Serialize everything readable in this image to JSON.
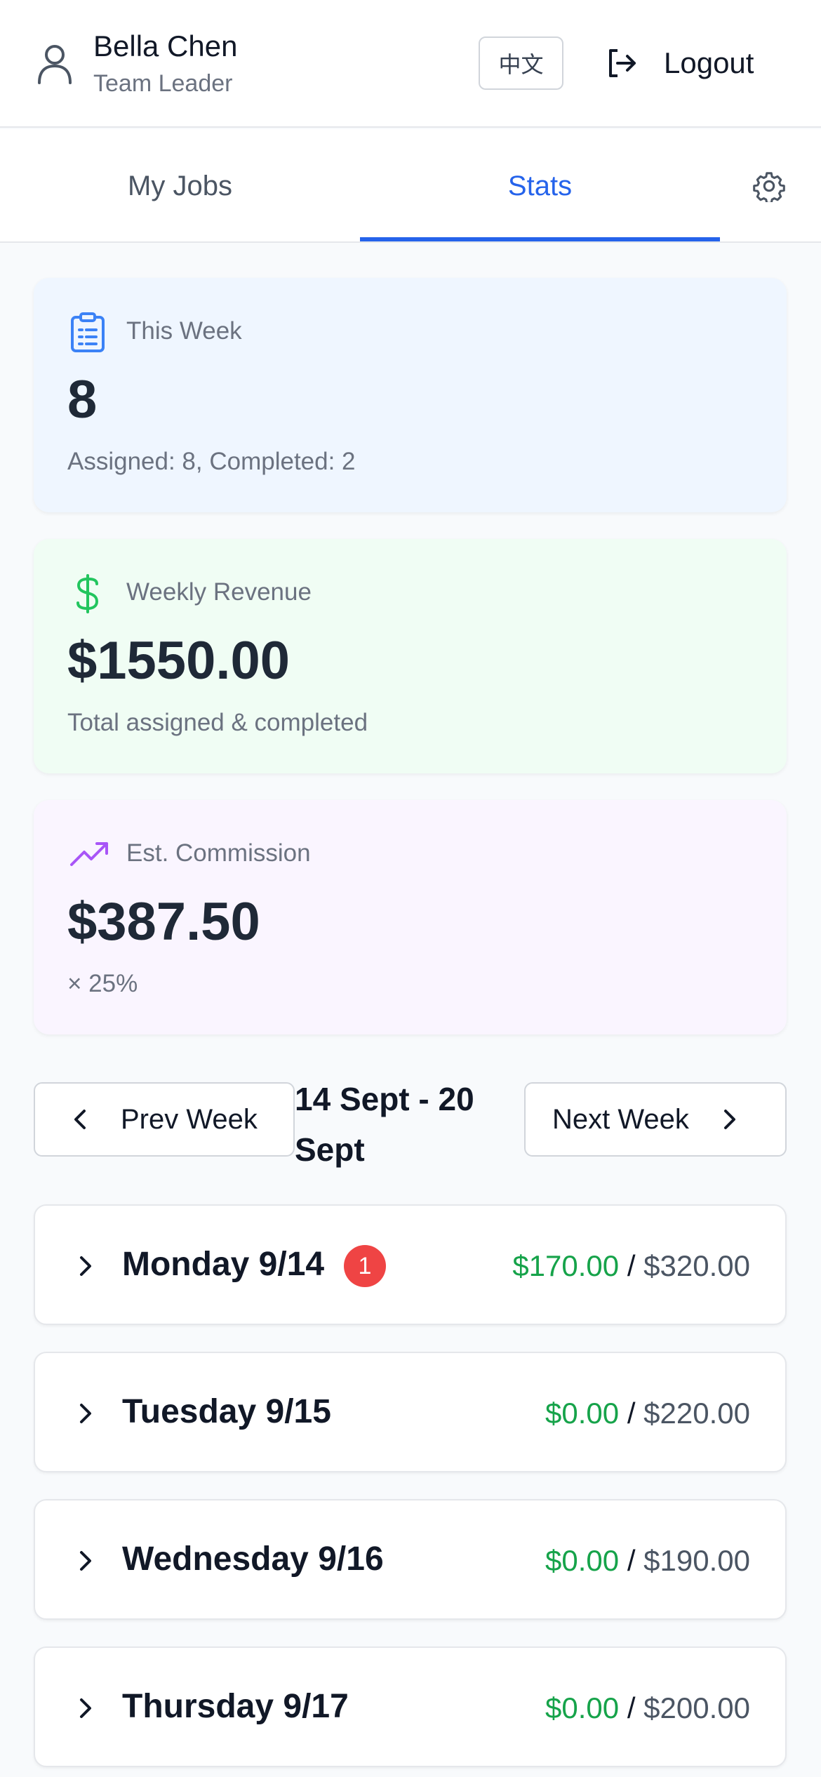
{
  "header": {
    "user_name": "Bella Chen",
    "user_role": "Team Leader",
    "language_label": "中文",
    "logout_label": "Logout"
  },
  "tabs": [
    {
      "label": "My Jobs",
      "active": false
    },
    {
      "label": "Stats",
      "active": true
    }
  ],
  "stats": {
    "this_week": {
      "label": "This Week",
      "value": "8",
      "sub": "Assigned: 8, Completed: 2",
      "icon": "clipboard-icon"
    },
    "weekly_revenue": {
      "label": "Weekly Revenue",
      "value": "$1550.00",
      "sub": "Total assigned & completed",
      "icon": "dollar-icon"
    },
    "commission": {
      "label": "Est. Commission",
      "value": "$387.50",
      "sub": "× 25%",
      "icon": "trending-up-icon"
    }
  },
  "week_nav": {
    "prev_label": "Prev Week",
    "range": "14 Sept - 20 Sept",
    "next_label": "Next Week"
  },
  "days": [
    {
      "label": "Monday 9/14",
      "badge": "1",
      "completed": "$170.00",
      "separator": "/",
      "total": "$320.00"
    },
    {
      "label": "Tuesday 9/15",
      "badge": null,
      "completed": "$0.00",
      "separator": "/",
      "total": "$220.00"
    },
    {
      "label": "Wednesday 9/16",
      "badge": null,
      "completed": "$0.00",
      "separator": "/",
      "total": "$190.00"
    },
    {
      "label": "Thursday 9/17",
      "badge": null,
      "completed": "$0.00",
      "separator": "/",
      "total": "$200.00"
    }
  ],
  "colors": {
    "accent": "#2563eb",
    "success": "#16a34a",
    "danger": "#ef4444",
    "card_blue": "#eff6ff",
    "card_green": "#f0fdf4",
    "card_purple": "#faf5ff"
  }
}
